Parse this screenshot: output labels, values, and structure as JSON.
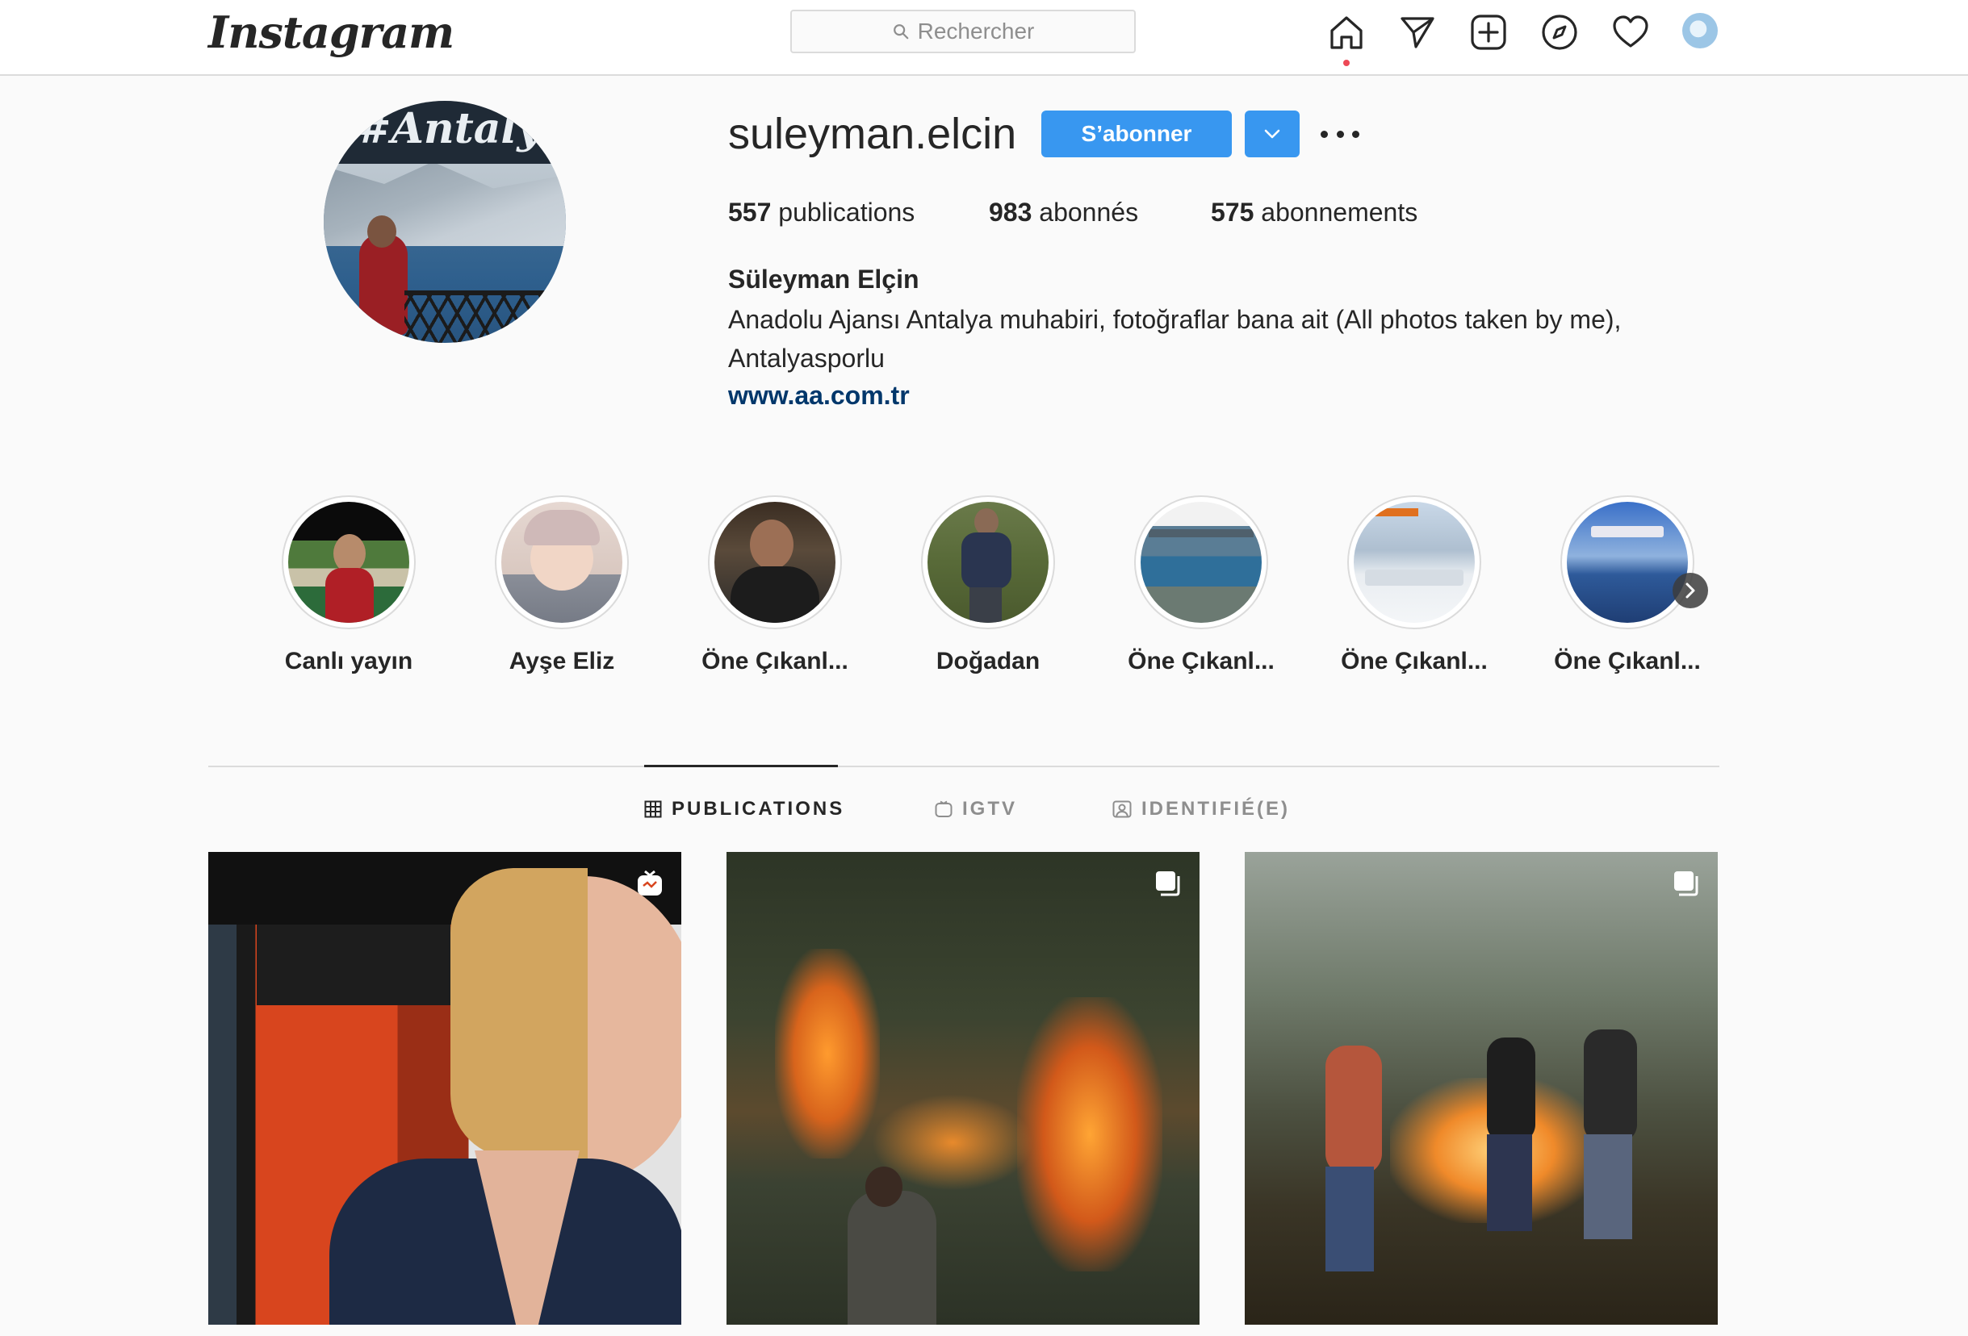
{
  "nav": {
    "logo": "Instagram",
    "search_placeholder": "Rechercher",
    "icons": [
      "home-icon",
      "direct-icon",
      "new-post-icon",
      "explore-icon",
      "activity-icon",
      "profile-avatar"
    ]
  },
  "profile": {
    "username": "suleyman.elcin",
    "follow_label": "S’abonner",
    "stats": {
      "posts_count": "557",
      "posts_label": "publications",
      "followers_count": "983",
      "followers_label": "abonnés",
      "following_count": "575",
      "following_label": "abonnements"
    },
    "full_name": "Süleyman Elçin",
    "bio": "Anadolu Ajansı Antalya muhabiri, fotoğraflar bana ait (All photos taken by me), Antalyasporlu",
    "website": "www.aa.com.tr",
    "avatar_text": "#Antalya"
  },
  "highlights": [
    {
      "label": "Canlı yayın"
    },
    {
      "label": "Ayşe Eliz"
    },
    {
      "label": "Öne Çıkanl..."
    },
    {
      "label": "Doğadan"
    },
    {
      "label": "Öne Çıkanl..."
    },
    {
      "label": "Öne Çıkanl..."
    },
    {
      "label": "Öne Çıkanl..."
    }
  ],
  "tabs": [
    {
      "label": "PUBLICATIONS",
      "active": true
    },
    {
      "label": "IGTV",
      "active": false
    },
    {
      "label": "IDENTIFIÉ(E)",
      "active": false
    }
  ],
  "posts": [
    {
      "type": "igtv",
      "badge_icon": "igtv-icon"
    },
    {
      "type": "carousel",
      "badge_icon": "carousel-icon"
    },
    {
      "type": "carousel",
      "badge_icon": "carousel-icon"
    }
  ],
  "colors": {
    "accent": "#3897f0",
    "link": "#00376b",
    "background": "#fafafa",
    "border": "#dbdbdb",
    "text": "#262626",
    "notification_dot": "#ed4956"
  }
}
